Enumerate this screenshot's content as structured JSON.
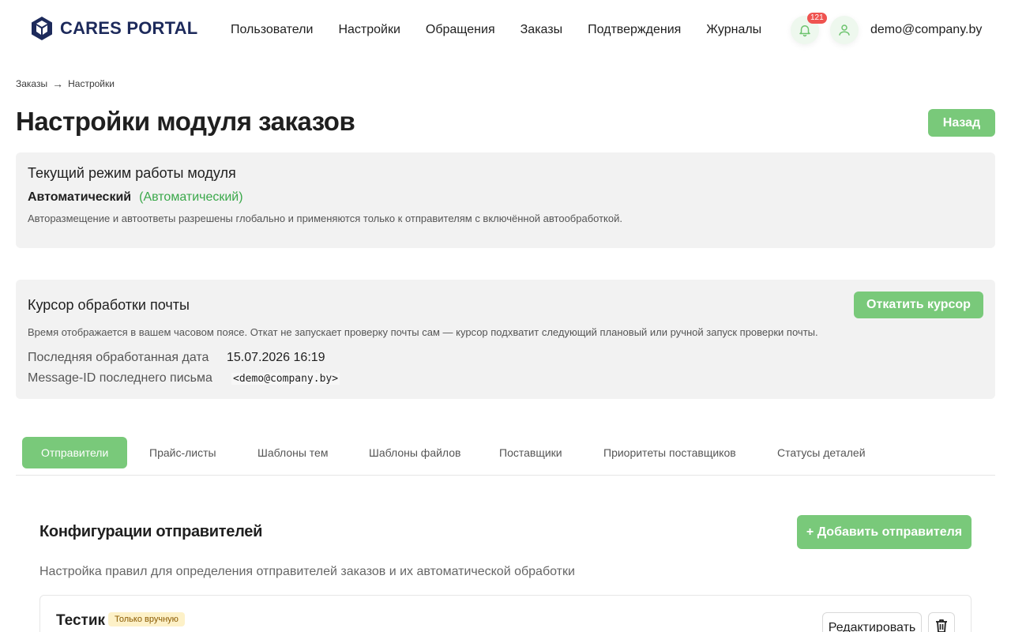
{
  "app": {
    "brand": "CARES PORTAL"
  },
  "nav": [
    "Пользователи",
    "Настройки",
    "Обращения",
    "Заказы",
    "Подтверждения",
    "Журналы"
  ],
  "header": {
    "notifications_count": "121",
    "user_email": "demo@company.by"
  },
  "breadcrumb": {
    "parent": "Заказы",
    "separator": "→",
    "current": "Настройки"
  },
  "page": {
    "title": "Настройки модуля заказов",
    "back_label": "Назад"
  },
  "mode_panel": {
    "title": "Текущий режим работы модуля",
    "value": "Автоматический",
    "value_hint": "(Автоматический)",
    "description": "Авторазмещение и автоответы разрешены глобально и применяются только к отправителям с включённой автообработкой."
  },
  "cursor_panel": {
    "title": "Курсор обработки почты",
    "rollback_label": "Откатить курсор",
    "description": "Время отображается в вашем часовом поясе. Откат не запускает проверку почты сам — курсор подхватит следующий плановый или ручной запуск проверки почты.",
    "last_date_label": "Последняя обработанная дата",
    "last_date_value": "15.07.2026 16:19",
    "message_id_label": "Message-ID последнего письма",
    "message_id_value": "<demo@company.by>"
  },
  "tabs": [
    "Отправители",
    "Прайс-листы",
    "Шаблоны тем",
    "Шаблоны файлов",
    "Поставщики",
    "Приоритеты поставщиков",
    "Статусы деталей"
  ],
  "senders": {
    "title": "Конфигурации отправителей",
    "add_label": "+ Добавить отправителя",
    "description": "Настройка правил для определения отправителей заказов и их автоматической обработки",
    "items": [
      {
        "name": "Тестик",
        "badge": "Только вручную",
        "edit_label": "Редактировать"
      }
    ]
  },
  "colors": {
    "accent": "#79c97a",
    "brand": "#1d2a5b",
    "success_text": "#3aa84a",
    "badge_bg": "#fdf1c8",
    "notification": "#ef5350"
  },
  "icons": {
    "bell": "bell-icon",
    "user": "user-icon",
    "trash": "trash-icon",
    "logo": "logo-icon"
  }
}
